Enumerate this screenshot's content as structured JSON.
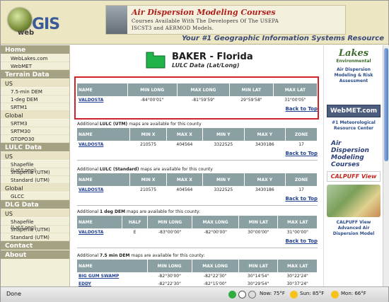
{
  "header": {
    "logo_prefix": "web",
    "logo_main": "GIS",
    "banner_title": "Air Dispersion Modeling Courses",
    "banner_line2": "Courses Available With The Developers Of The USEPA",
    "banner_line3": "ISCST3 and AERMOD Models.",
    "tagline": "Your #1 Geographic Information Systems Resource"
  },
  "sidebar": {
    "home": "Home",
    "home_items": [
      "WebLakes.com",
      "WebMET"
    ],
    "terrain": "Terrain Data",
    "us": "US",
    "terrain_us_items": [
      "7.5-min DEM",
      "1-deg DEM",
      "SRTM1"
    ],
    "global": "Global",
    "terrain_global_items": [
      "SRTM3",
      "SRTM30",
      "GTOPO30"
    ],
    "lulc": "LULC Data",
    "lulc_us_items": [
      "Shapefile (Lat/Long)",
      "Shapefile (UTM)",
      "Standard (UTM)"
    ],
    "lulc_global_items": [
      "GLCC"
    ],
    "dlg": "DLG Data",
    "dlg_us_items": [
      "Shapefile (Lat/Long)",
      "Shapefile (UTM)",
      "Standard (UTM)"
    ],
    "contact": "Contact",
    "about": "About"
  },
  "main": {
    "county_title": "BAKER - Florida",
    "county_subtitle": "LULC Data (Lat/Long)",
    "back_to_top": "Back to Top",
    "table1": {
      "headers": [
        "NAME",
        "MIN LONG",
        "MAX LONG",
        "MIN LAT",
        "MAX LAT"
      ],
      "rows": [
        [
          "VALDOSTA",
          "-84°00'01\"",
          "-81°59'59\"",
          "29°59'58\"",
          "31°00'05\""
        ]
      ]
    },
    "table2": {
      "note_pre": "Additional",
      "note_bold": "LULC (UTM)",
      "note_post": "maps are available for this county",
      "headers": [
        "NAME",
        "MIN X",
        "MAX X",
        "MIN Y",
        "MAX Y",
        "ZONE"
      ],
      "rows": [
        [
          "VALDOSTA",
          "210575",
          "404564",
          "3322525",
          "3430186",
          "17"
        ]
      ]
    },
    "table3": {
      "note_pre": "Additional",
      "note_bold": "LULC (Standard)",
      "note_post": "maps are available for this county",
      "headers": [
        "NAME",
        "MIN X",
        "MAX X",
        "MIN Y",
        "MAX Y",
        "ZONE"
      ],
      "rows": [
        [
          "VALDOSTA",
          "210575",
          "404564",
          "3322525",
          "3430186",
          "17"
        ]
      ]
    },
    "table4": {
      "note_pre": "Additional",
      "note_bold": "1 deg DEM",
      "note_post": "maps are available for this county:",
      "headers": [
        "NAME",
        "HALF",
        "MIN LONG",
        "MAX LONG",
        "MIN LAT",
        "MAX LAT"
      ],
      "rows": [
        [
          "VALDOSTA",
          "E",
          "-83°00'00\"",
          "-82°00'00\"",
          "30°00'00\"",
          "31°00'00\""
        ]
      ]
    },
    "table5": {
      "note_pre": "Additional",
      "note_bold": "7.5 min DEM",
      "note_post": "maps are available for this county:",
      "headers": [
        "NAME",
        "MIN LONG",
        "MAX LONG",
        "MIN LAT",
        "MAX LAT"
      ],
      "rows": [
        [
          "BIG GUM SWAMP",
          "-82°30'00\"",
          "-82°22'30\"",
          "30°14'54\"",
          "30°22'24\""
        ],
        [
          "EDDY",
          "-82°22'30\"",
          "-82°15'00\"",
          "30°29'54\"",
          "30°37'24\""
        ]
      ]
    }
  },
  "rightcol": {
    "lakes_logo": "Lakes",
    "lakes_sub": "Environmental",
    "lakes_text": "Air Dispersion Modeling & Risk Assessment",
    "webmet_logo": "WebMET.com",
    "webmet_text": "#1 Meteorological Resource Center",
    "disp_logo": "Air Dispersion Modeling Courses",
    "calpuff_tag": "CALPUFF View",
    "calpuff_text": "CALPUFF View Advanced Air Dispersion Model"
  },
  "status": {
    "text": "Done",
    "now": "Now: 75°F",
    "sun": "Sun: 85°F",
    "mon": "Mon: 66°F"
  }
}
